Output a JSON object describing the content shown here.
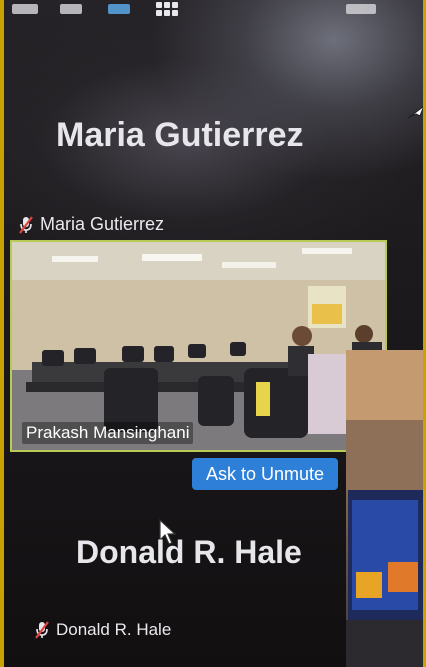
{
  "top_tile": {
    "display_name": "Maria Gutierrez",
    "label": "Maria Gutierrez",
    "muted": true
  },
  "video_tile": {
    "label": "Prakash Mansinghani",
    "active_speaker_color": "#b7cc55"
  },
  "ask_to_unmute": {
    "label": "Ask to Unmute",
    "color": "#2d7fd8"
  },
  "bottom_tile": {
    "display_name": "Donald R. Hale",
    "label": "Donald R. Hale",
    "muted": true
  },
  "icons": [
    "grid-view-icon",
    "muted-mic-icon",
    "pointer-cursor-icon"
  ]
}
